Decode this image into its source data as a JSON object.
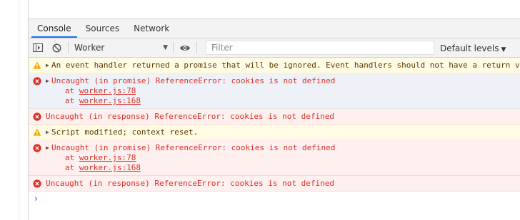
{
  "tabs": [
    {
      "label": "Console",
      "active": true
    },
    {
      "label": "Sources",
      "active": false
    },
    {
      "label": "Network",
      "active": false
    }
  ],
  "toolbar": {
    "context": "Worker",
    "filter_placeholder": "Filter",
    "levels_label": "Default levels"
  },
  "messages": [
    {
      "type": "warning",
      "text": "An event handler returned a promise that will be ignored. Event handlers should not have a return v"
    },
    {
      "type": "error",
      "text": "Uncaught (in promise) ReferenceError: cookies is not defined",
      "stack": [
        {
          "prefix": "at ",
          "link": "worker.js:78"
        },
        {
          "prefix": "at ",
          "link": "worker.js:168"
        }
      ]
    },
    {
      "type": "error",
      "text": "Uncaught (in response) ReferenceError: cookies is not defined"
    },
    {
      "type": "warning",
      "text": "Script modified; context reset."
    },
    {
      "type": "error",
      "text": "Uncaught (in promise) ReferenceError: cookies is not defined",
      "stack": [
        {
          "prefix": "at ",
          "link": "worker.js:78"
        },
        {
          "prefix": "at ",
          "link": "worker.js:168"
        }
      ]
    },
    {
      "type": "error",
      "text": "Uncaught (in response) ReferenceError: cookies is not defined"
    }
  ],
  "colors": {
    "error": "#d93025",
    "warning_icon": "#f2a600",
    "accent": "#1a73e8"
  }
}
